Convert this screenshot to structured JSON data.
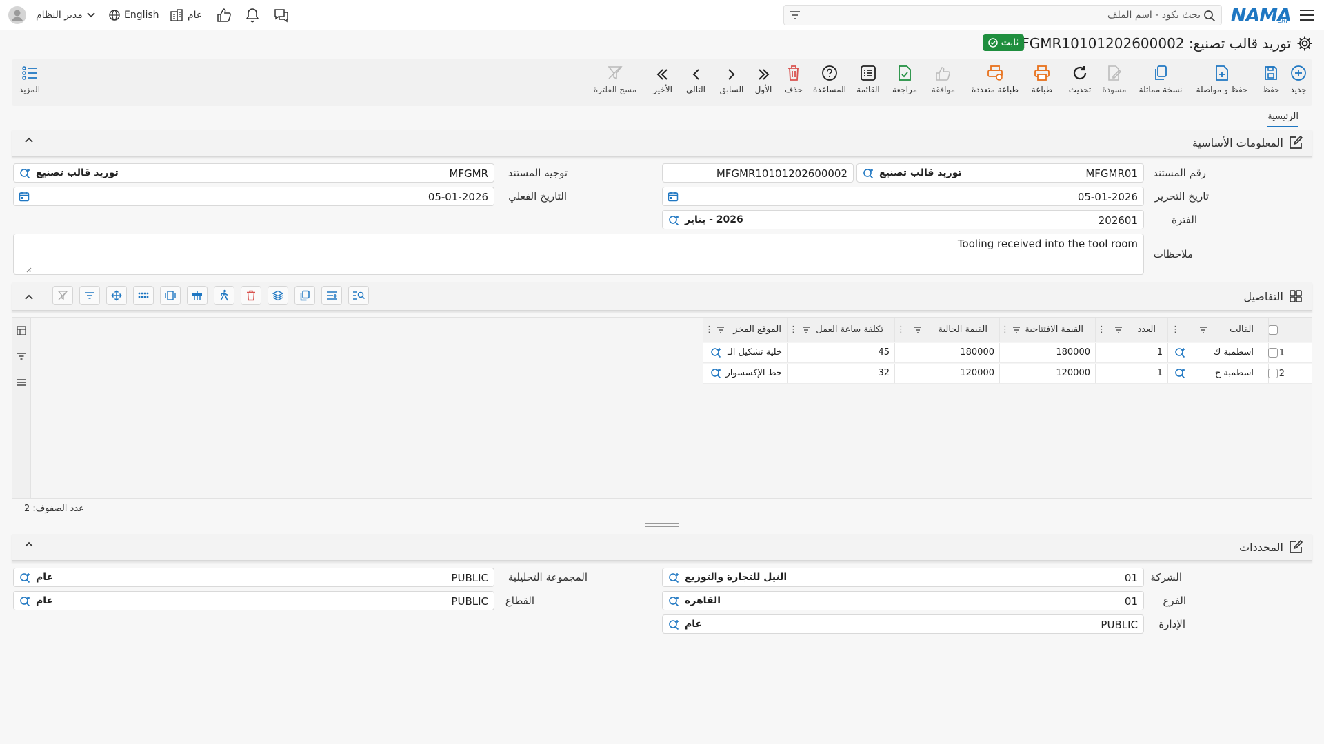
{
  "app": {
    "logo": "NAMA",
    "logo_sub": "ERP"
  },
  "topbar": {
    "search_placeholder": "بحث بكود - اسم الملف",
    "user": "مدير النظام",
    "language": "English",
    "scope": "عام"
  },
  "document": {
    "title": "توريد قالب تصنيع: MFGMR10101202600002",
    "status": "ثابت"
  },
  "toolbar": {
    "new": "جديد",
    "save": "حفظ",
    "save_continue": "حفظ و مواصلة",
    "copy": "نسخة مماثلة",
    "draft": "مسودة",
    "refresh": "تحديث",
    "print": "طباعة",
    "multi_print": "طباعة متعددة",
    "approve": "موافقة",
    "review": "مراجعة",
    "list": "القائمة",
    "help": "المساعدة",
    "delete": "حذف",
    "first": "الأول",
    "previous": "السابق",
    "next": "التالي",
    "last": "الأخير",
    "clear_filter": "مسح الفلترة",
    "more": "المزيد"
  },
  "tabs": {
    "main": "الرئيسية"
  },
  "basic_info": {
    "title": "المعلومات الأساسية",
    "doc_number_label": "رقم المستند",
    "doc_type_code": "MFGMR01",
    "doc_type_name": "توريد قالب تصنيع",
    "doc_number": "MFGMR10101202600002",
    "direction_label": "توجيه المستند",
    "direction_code": "MFGMR",
    "direction_name": "توريد قالب تصنيع",
    "edit_date_label": "تاريخ التحرير",
    "edit_date": "05-01-2026",
    "actual_date_label": "التاريخ الفعلي",
    "actual_date": "05-01-2026",
    "period_label": "الفترة",
    "period_code": "202601",
    "period_name": "2026 - يناير",
    "notes_label": "ملاحظات",
    "notes": "Tooling received into the tool room"
  },
  "details": {
    "title": "التفاصيل",
    "columns": [
      "القالب",
      "العدد",
      "القيمة الافتتاحية",
      "القيمة الحالية",
      "تكلفة ساعة العمل",
      "الموقع المخز"
    ],
    "rows": [
      {
        "num": "1",
        "mold": "اسطمبة ك",
        "qty": "1",
        "opening": "180000",
        "current": "180000",
        "hour_cost": "45",
        "location": "خلية تشكيل الـ"
      },
      {
        "num": "2",
        "mold": "اسطمبة ج",
        "qty": "1",
        "opening": "120000",
        "current": "120000",
        "hour_cost": "32",
        "location": "خط الإكسسوار"
      }
    ],
    "row_count": "عدد الصفوف: 2"
  },
  "dimensions": {
    "title": "المحددات",
    "company_label": "الشركة",
    "company_code": "01",
    "company_name": "النيل للتجارة والتوزيع",
    "analytic_label": "المجموعة التحليلية",
    "analytic_code": "PUBLIC",
    "analytic_name": "عام",
    "branch_label": "الفرع",
    "branch_code": "01",
    "branch_name": "القاهرة",
    "sector_label": "القطاع",
    "sector_code": "PUBLIC",
    "sector_name": "عام",
    "department_label": "الإدارة",
    "department_code": "PUBLIC",
    "department_name": "عام"
  },
  "colors": {
    "accent": "#1f77c2",
    "status_green": "#1e8e3e",
    "danger": "#d9534f",
    "print_orange": "#e8711c"
  }
}
